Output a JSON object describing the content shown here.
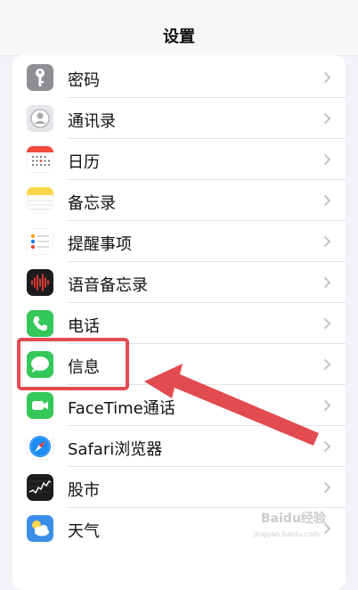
{
  "nav": {
    "title": "设置"
  },
  "rows": [
    {
      "label": "密码",
      "icon": "key-icon"
    },
    {
      "label": "通讯录",
      "icon": "contacts-icon"
    },
    {
      "label": "日历",
      "icon": "calendar-icon"
    },
    {
      "label": "备忘录",
      "icon": "notes-icon"
    },
    {
      "label": "提醒事项",
      "icon": "reminders-icon"
    },
    {
      "label": "语音备忘录",
      "icon": "voice-memos-icon"
    },
    {
      "label": "电话",
      "icon": "phone-icon"
    },
    {
      "label": "信息",
      "icon": "messages-icon"
    },
    {
      "label": "FaceTime通话",
      "icon": "facetime-icon"
    },
    {
      "label": "Safari浏览器",
      "icon": "safari-icon"
    },
    {
      "label": "股市",
      "icon": "stocks-icon"
    },
    {
      "label": "天气",
      "icon": "weather-icon"
    }
  ],
  "watermark": {
    "text": "Baidu经验",
    "url": "jingyan.baidu.com"
  },
  "colors": {
    "annotation": "#e24b50",
    "chevron": "#c4c4c7"
  }
}
